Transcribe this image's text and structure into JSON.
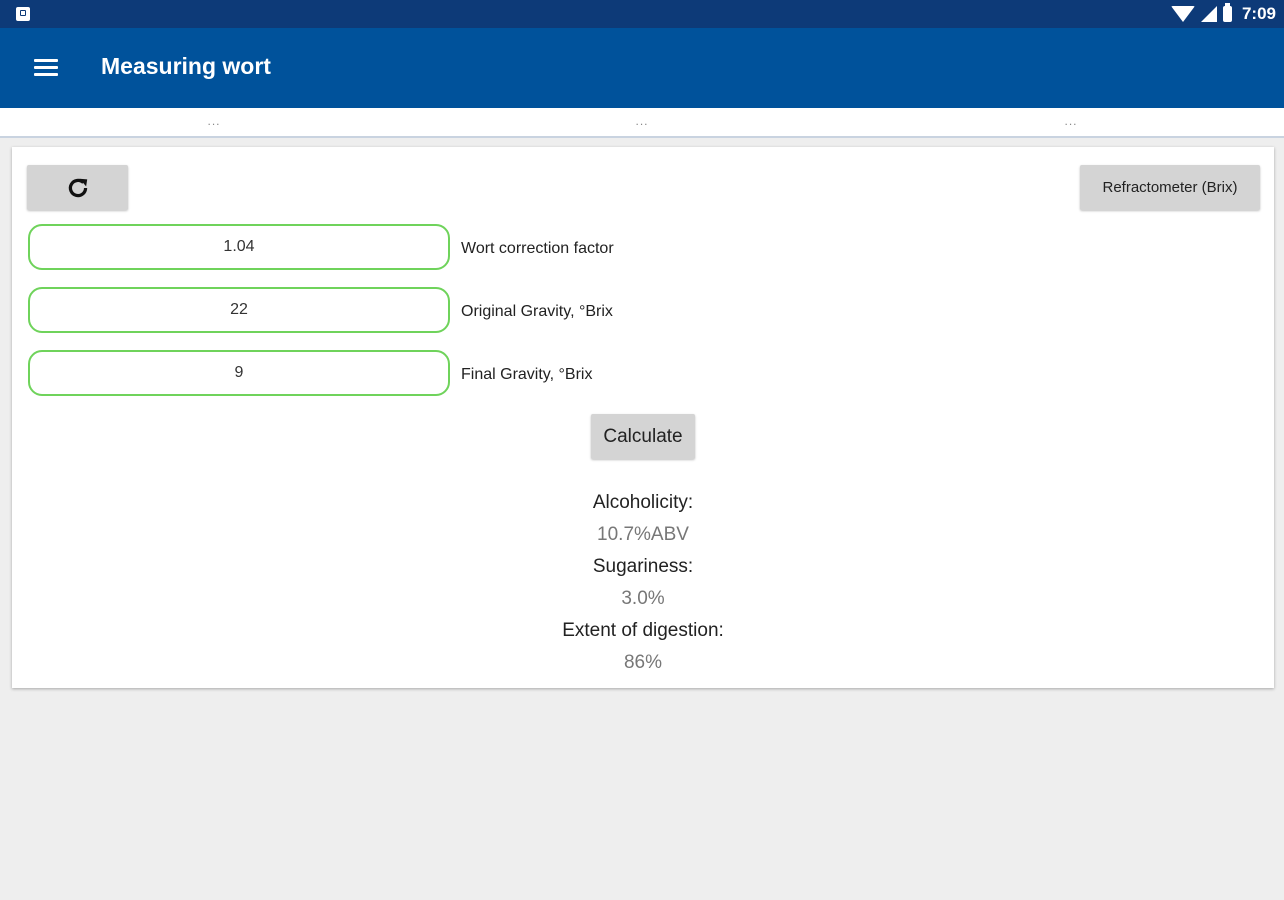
{
  "status_bar": {
    "time": "7:09"
  },
  "app_bar": {
    "title": "Measuring wort",
    "menu_icon": "hamburger-menu-icon"
  },
  "tabs": [
    "...",
    "...",
    "..."
  ],
  "toolbar": {
    "refresh_icon": "refresh-icon",
    "mode_button": "Refractometer (Brix)"
  },
  "inputs": [
    {
      "value": "1.04",
      "label": "Wort correction factor"
    },
    {
      "value": "22",
      "label": "Original Gravity, °Brix"
    },
    {
      "value": "9",
      "label": "Final Gravity, °Brix"
    }
  ],
  "calculate_label": "Calculate",
  "results": {
    "alcoholicity_label": "Alcoholicity:",
    "alcoholicity_value": "10.7%ABV",
    "sugariness_label": "Sugariness:",
    "sugariness_value": "3.0%",
    "digestion_label": "Extent of digestion:",
    "digestion_value": "86%"
  },
  "colors": {
    "status_bar": "#0d3a78",
    "app_bar": "#00529b",
    "field_border": "#6fd35b",
    "button": "#d4d4d4",
    "background": "#eeeeee"
  }
}
